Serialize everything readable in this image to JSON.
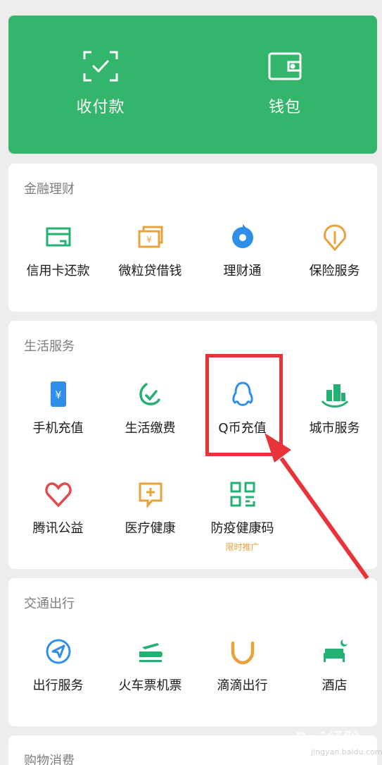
{
  "top": {
    "pay": {
      "label": "收付款",
      "icon": "scan-pay-icon"
    },
    "wallet": {
      "label": "钱包",
      "icon": "wallet-icon"
    }
  },
  "finance": {
    "title": "金融理财",
    "items": [
      {
        "label": "信用卡还款",
        "icon": "credit-card-icon",
        "color": "#22b173"
      },
      {
        "label": "微粒贷借钱",
        "icon": "loan-icon",
        "color": "#e9a13b"
      },
      {
        "label": "理财通",
        "icon": "wealth-icon",
        "color": "#2f8fe8"
      },
      {
        "label": "保险服务",
        "icon": "insurance-icon",
        "color": "#e9a13b"
      }
    ]
  },
  "life": {
    "title": "生活服务",
    "items": [
      {
        "label": "手机充值",
        "icon": "phone-topup-icon",
        "color": "#2f8fe8"
      },
      {
        "label": "生活缴费",
        "icon": "utility-bill-icon",
        "color": "#22b173"
      },
      {
        "label": "Q币充值",
        "icon": "qq-icon",
        "color": "#2f8fe8"
      },
      {
        "label": "城市服务",
        "icon": "city-services-icon",
        "color": "#22b173"
      },
      {
        "label": "腾讯公益",
        "icon": "charity-icon",
        "color": "#e04a4a"
      },
      {
        "label": "医疗健康",
        "icon": "medical-icon",
        "color": "#e9a13b"
      },
      {
        "label": "防疫健康码",
        "icon": "qr-code-icon",
        "color": "#22b173",
        "tag": "限时推广"
      }
    ]
  },
  "transport": {
    "title": "交通出行",
    "items": [
      {
        "label": "出行服务",
        "icon": "navigation-icon",
        "color": "#2f8fe8"
      },
      {
        "label": "火车票机票",
        "icon": "train-plane-icon",
        "color": "#22b173"
      },
      {
        "label": "滴滴出行",
        "icon": "didi-icon",
        "color": "#e9a13b"
      },
      {
        "label": "酒店",
        "icon": "hotel-icon",
        "color": "#22b173"
      }
    ]
  },
  "shopping": {
    "title": "购物消费"
  },
  "watermark": {
    "text": "Bai经验",
    "sub": "jingyan.baidu.com"
  }
}
